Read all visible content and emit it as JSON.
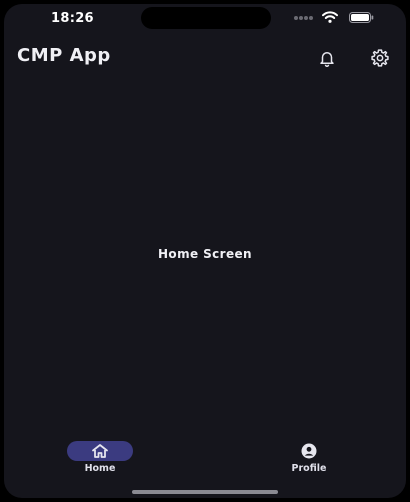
{
  "status_bar": {
    "time": "18:26"
  },
  "app_bar": {
    "title": "CMP App",
    "actions": [
      {
        "icon": "bell-icon"
      },
      {
        "icon": "gear-icon"
      }
    ]
  },
  "content": {
    "center_text": "Home Screen"
  },
  "bottom_nav": {
    "items": [
      {
        "label": "Home",
        "icon": "home-icon",
        "selected": true
      },
      {
        "label": "Profile",
        "icon": "profile-icon",
        "selected": false
      }
    ]
  },
  "colors": {
    "background": "#15151c",
    "nav_pill": "#3b3b80",
    "text": "#f0f0f5"
  }
}
